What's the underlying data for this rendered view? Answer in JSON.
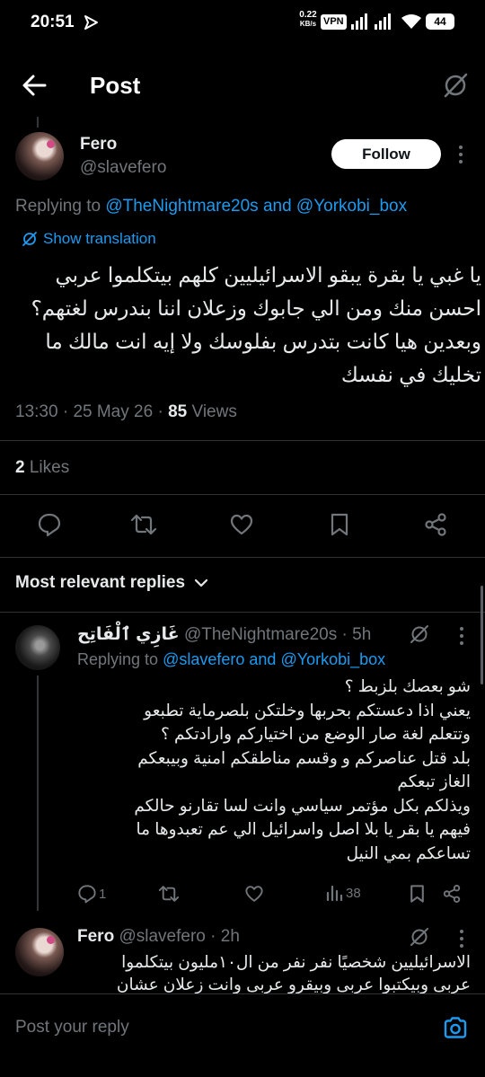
{
  "status_bar": {
    "time": "20:51",
    "net_speed_top": "0.22",
    "net_speed_bottom": "KB/s",
    "vpn": "VPN",
    "battery": "44"
  },
  "header": {
    "title": "Post"
  },
  "main_post": {
    "display_name": "Fero",
    "handle": "@slavefero",
    "follow_label": "Follow",
    "replying_prefix": "Replying to",
    "replying_user1": "@TheNightmare20s",
    "replying_and": "and",
    "replying_user2": "@Yorkobi_box",
    "show_translation": "Show translation",
    "text": "يا غبي يا بقرة يبقو الاسرائيليين كلهم بيتكلموا عربي احسن منك ومن الي جابوك وزعلان اننا بندرس لغتهم؟ وبعدين هيا كانت بتدرس بفلوسك ولا إيه انت مالك ما تخليك في نفسك",
    "time": "13:30",
    "date": "25 May 26",
    "views_count": "85",
    "views_label": "Views",
    "likes_count": "2",
    "likes_label": "Likes"
  },
  "sort": {
    "label": "Most relevant replies"
  },
  "reply1": {
    "display_name": "غَازِي ٱلْفَاتِح",
    "handle": "@TheNightmare20s",
    "time": "5h",
    "replying_prefix": "Replying to",
    "replying_user1": "@slavefero",
    "replying_and": "and",
    "replying_user2": "@Yorkobi_box",
    "lines": [
      "شو بعصك بلزبط ؟",
      "يعني  اذا دعستكم بحربها وخلتكن بلصرماية تطبعو",
      "وتتعلم لغة صار الوضع من اختياركم وارادتكم ؟",
      "بلد قتل عناصركم و وقسم مناطقكم امنية وبيبعكم",
      "الغاز تبعكم",
      "ويذلكم بكل مؤتمر سياسي وانت لسا تقارنو حالكم",
      "فيهم يا بقر يا بلا اصل واسرائيل الي عم تعبدوها ما",
      "تساعكم بمي النيل"
    ],
    "reply_count": "1",
    "view_count": "38"
  },
  "reply2": {
    "display_name": "Fero",
    "handle": "@slavefero",
    "time": "2h",
    "lines": [
      "الاسرائيليين شخصيًا نفر نفر من ال١٠مليون بيتكلموا",
      "عربى وبيكتبوا عربى وبيقرو عربى وانت زعلان عشان"
    ]
  },
  "composer": {
    "placeholder": "Post your reply"
  },
  "colors": {
    "background": "#000000",
    "text": "#e7e9ea",
    "muted": "#71767b",
    "link": "#1d9bf0",
    "divider": "#2f3336"
  }
}
